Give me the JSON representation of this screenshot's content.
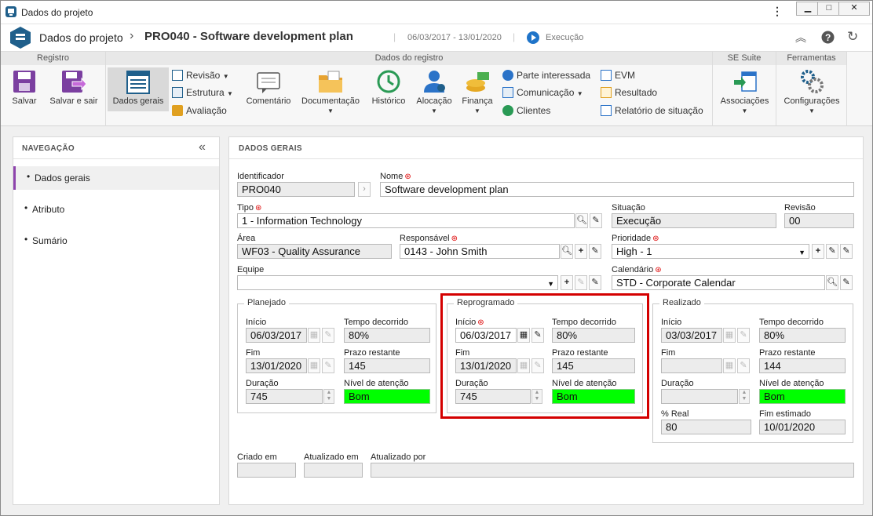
{
  "window": {
    "title": "Dados do projeto"
  },
  "header": {
    "module": "Dados do projeto",
    "record_title": "PRO040 - Software development plan",
    "dates": "06/03/2017 - 13/01/2020",
    "status": "Execução"
  },
  "ribbon": {
    "groups": [
      "Registro",
      "Dados do registro",
      "SE Suite",
      "Ferramentas"
    ],
    "save": "Salvar",
    "save_exit": "Salvar e sair",
    "general": "Dados gerais",
    "revision": "Revisão",
    "structure": "Estrutura",
    "evaluation": "Avaliação",
    "comment": "Comentário",
    "documentation": "Documentação",
    "history": "Histórico",
    "allocation": "Alocação",
    "finance": "Finança",
    "stakeholder": "Parte interessada",
    "communication": "Comunicação",
    "clients": "Clientes",
    "evm": "EVM",
    "result": "Resultado",
    "status_report": "Relatório de situação",
    "associations": "Associações",
    "settings": "Configurações"
  },
  "nav": {
    "title": "NAVEGAÇÃO",
    "items": [
      "Dados gerais",
      "Atributo",
      "Sumário"
    ]
  },
  "main": {
    "title": "DADOS GERAIS",
    "labels": {
      "identifier": "Identificador",
      "name": "Nome",
      "type": "Tipo",
      "situation": "Situação",
      "revision": "Revisão",
      "area": "Área",
      "responsible": "Responsável",
      "priority": "Prioridade",
      "team": "Equipe",
      "calendar": "Calendário"
    },
    "values": {
      "identifier": "PRO040",
      "name": "Software development plan",
      "type": "1 - Information Technology",
      "situation": "Execução",
      "revision": "00",
      "area": "WF03 - Quality Assurance",
      "responsible": "0143 - John Smith",
      "priority": "High - 1",
      "team": "",
      "calendar": "STD - Corporate Calendar"
    },
    "planned": {
      "legend": "Planejado",
      "start_label": "Início",
      "start": "06/03/2017",
      "elapsed_label": "Tempo decorrido",
      "elapsed": "80%",
      "end_label": "Fim",
      "end": "13/01/2020",
      "remaining_label": "Prazo restante",
      "remaining": "145",
      "duration_label": "Duração",
      "duration": "745",
      "attention_label": "Nível de atenção",
      "attention": "Bom"
    },
    "replanned": {
      "legend": "Reprogramado",
      "start_label": "Início",
      "start": "06/03/2017",
      "elapsed_label": "Tempo decorrido",
      "elapsed": "80%",
      "end_label": "Fim",
      "end": "13/01/2020",
      "remaining_label": "Prazo restante",
      "remaining": "145",
      "duration_label": "Duração",
      "duration": "745",
      "attention_label": "Nível de atenção",
      "attention": "Bom"
    },
    "actual": {
      "legend": "Realizado",
      "start_label": "Início",
      "start": "03/03/2017",
      "elapsed_label": "Tempo decorrido",
      "elapsed": "80%",
      "end_label": "Fim",
      "end": "",
      "remaining_label": "Prazo restante",
      "remaining": "144",
      "duration_label": "Duração",
      "duration": "",
      "attention_label": "Nível de atenção",
      "attention": "Bom",
      "real_label": "% Real",
      "real": "80",
      "est_end_label": "Fim estimado",
      "est_end": "10/01/2020"
    },
    "footer": {
      "created_label": "Criado em",
      "created": "",
      "updated_label": "Atualizado em",
      "updated": "",
      "updated_by_label": "Atualizado por",
      "updated_by": ""
    }
  },
  "colors": {
    "accent": "#1f5f8b",
    "highlight": "#d40000",
    "attention_good": "#00ff00",
    "nav_active": "#8e44ad"
  }
}
